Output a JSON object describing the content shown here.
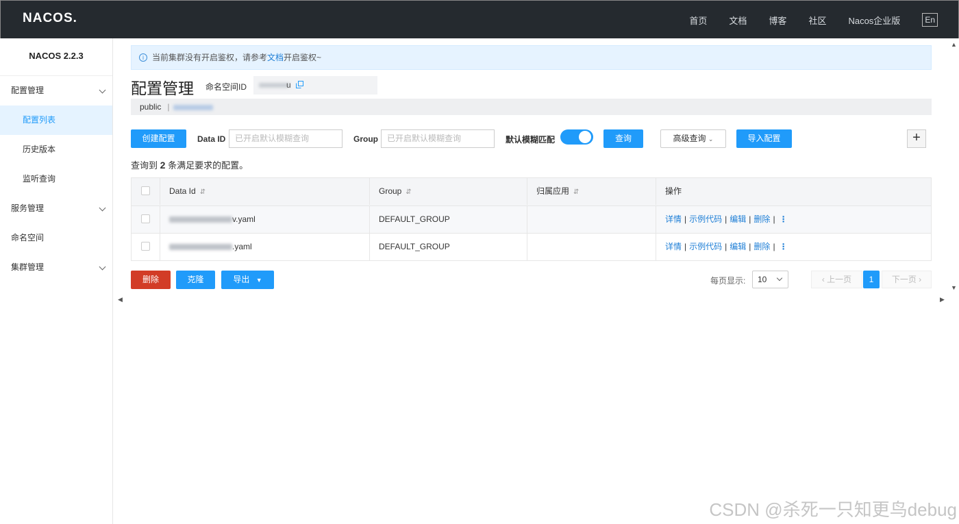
{
  "header": {
    "logo": "NACOS.",
    "nav": [
      "首页",
      "文档",
      "博客",
      "社区",
      "Nacos企业版"
    ],
    "lang": "En"
  },
  "sidebar": {
    "version": "NACOS 2.2.3",
    "items": [
      {
        "label": "配置管理",
        "type": "group"
      },
      {
        "label": "配置列表",
        "type": "sub",
        "active": true
      },
      {
        "label": "历史版本",
        "type": "sub"
      },
      {
        "label": "监听查询",
        "type": "sub"
      },
      {
        "label": "服务管理",
        "type": "group"
      },
      {
        "label": "命名空间",
        "type": "plain"
      },
      {
        "label": "集群管理",
        "type": "group"
      }
    ]
  },
  "notice": {
    "text_before": "当前集群没有开启鉴权，请参考",
    "link": "文档",
    "text_after": "开启鉴权~"
  },
  "page": {
    "title": "配置管理",
    "ns_label": "命名空间ID",
    "ns_value_tail": "u",
    "tab_public": "public",
    "tab_sep": "|"
  },
  "filters": {
    "create_label": "创建配置",
    "dataid_label": "Data ID",
    "dataid_placeholder": "已开启默认模糊查询",
    "group_label": "Group",
    "group_placeholder": "已开启默认模糊查询",
    "fuzzy_label": "默认模糊匹配",
    "search_label": "查询",
    "advanced_label": "高级查询",
    "import_label": "导入配置",
    "plus": "+"
  },
  "result": {
    "prefix": "查询到",
    "count": "2",
    "suffix": "条满足要求的配置。"
  },
  "table": {
    "columns": [
      "Data Id",
      "Group",
      "归属应用",
      "操作"
    ],
    "rows": [
      {
        "dataid_tail": "v.yaml",
        "group": "DEFAULT_GROUP",
        "app": ""
      },
      {
        "dataid_tail": ".yaml",
        "group": "DEFAULT_GROUP",
        "app": ""
      }
    ],
    "ops": [
      "详情",
      "示例代码",
      "编辑",
      "删除"
    ]
  },
  "bottom": {
    "delete_label": "删除",
    "clone_label": "克隆",
    "export_label": "导出",
    "page_size_label": "每页显示:",
    "page_size": "10",
    "prev_label": "上一页",
    "page": "1",
    "next_label": "下一页"
  },
  "watermark": "CSDN @杀死一只知更鸟debug"
}
